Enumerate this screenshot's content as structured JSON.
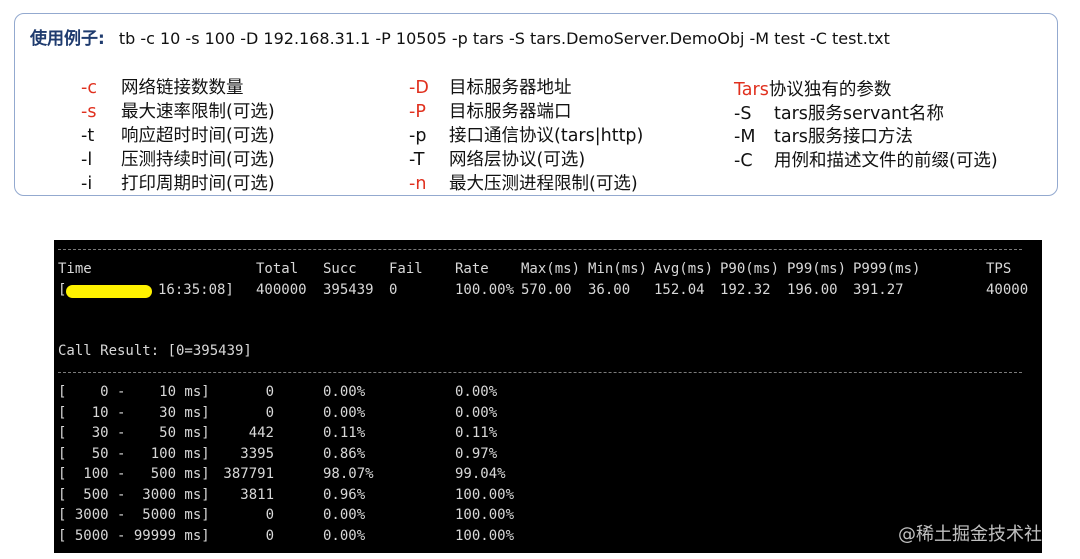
{
  "usage": {
    "label": "使用例子:",
    "command": "tb -c 10 -s 100 -D 192.168.31.1 -P 10505 -p tars -S tars.DemoServer.DemoObj -M test -C test.txt",
    "col1": [
      {
        "flag": "-c",
        "desc": "网络链接数数量"
      },
      {
        "flag": "-s",
        "desc": "最大速率限制(可选)"
      },
      {
        "flag": "-t",
        "desc": "响应超时时间(可选)"
      },
      {
        "flag": "-l",
        "desc": "压测持续时间(可选)"
      },
      {
        "flag": "-i",
        "desc": "打印周期时间(可选)"
      }
    ],
    "col2": [
      {
        "flag": "-D",
        "desc": "目标服务器地址"
      },
      {
        "flag": "-P",
        "desc": "目标服务器端口"
      },
      {
        "flag": "-p",
        "desc": "接口通信协议(tars|http)"
      },
      {
        "flag": "-T",
        "desc": "网络层协议(可选)"
      },
      {
        "flag": "-n",
        "desc": "最大压测进程限制(可选)"
      }
    ],
    "col3_title_red": "Tars",
    "col3_title_rest": "协议独有的参数",
    "col3": [
      {
        "flag": "-S",
        "desc": "tars服务servant名称"
      },
      {
        "flag": "-M",
        "desc": "tars服务接口方法"
      },
      {
        "flag": "-C",
        "desc": "用例和描述文件的前缀(可选)"
      }
    ],
    "red_color": "#e0301e"
  },
  "terminal": {
    "headers": [
      "Time",
      "Total",
      "Succ",
      "Fail",
      "Rate",
      "Max(ms)",
      "Min(ms)",
      "Avg(ms)",
      "P90(ms)",
      "P99(ms)",
      "P999(ms)",
      "TPS"
    ],
    "row": {
      "time_open": "[",
      "time": "16:35:08]",
      "total": "400000",
      "succ": "395439",
      "fail": "0",
      "rate": "100.00%",
      "max": "570.00",
      "min": "36.00",
      "avg": "152.04",
      "p90": "192.32",
      "p99": "196.00",
      "p999": "391.27",
      "tps": "40000"
    },
    "call_result": "Call Result: [0=395439]",
    "buckets": [
      {
        "range": "[    0 -    10 ms]",
        "count": "0",
        "pct": "0.00%",
        "cum": "0.00%"
      },
      {
        "range": "[   10 -    30 ms]",
        "count": "0",
        "pct": "0.00%",
        "cum": "0.00%"
      },
      {
        "range": "[   30 -    50 ms]",
        "count": "442",
        "pct": "0.11%",
        "cum": "0.11%"
      },
      {
        "range": "[   50 -   100 ms]",
        "count": "3395",
        "pct": "0.86%",
        "cum": "0.97%"
      },
      {
        "range": "[  100 -   500 ms]",
        "count": "387791",
        "pct": "98.07%",
        "cum": "99.04%"
      },
      {
        "range": "[  500 -  3000 ms]",
        "count": "3811",
        "pct": "0.96%",
        "cum": "100.00%"
      },
      {
        "range": "[ 3000 -  5000 ms]",
        "count": "0",
        "pct": "0.00%",
        "cum": "100.00%"
      },
      {
        "range": "[ 5000 - 99999 ms]",
        "count": "0",
        "pct": "0.00%",
        "cum": "100.00%"
      }
    ],
    "mask_color": "#fff200"
  },
  "watermark": "@稀土掘金技术社区"
}
